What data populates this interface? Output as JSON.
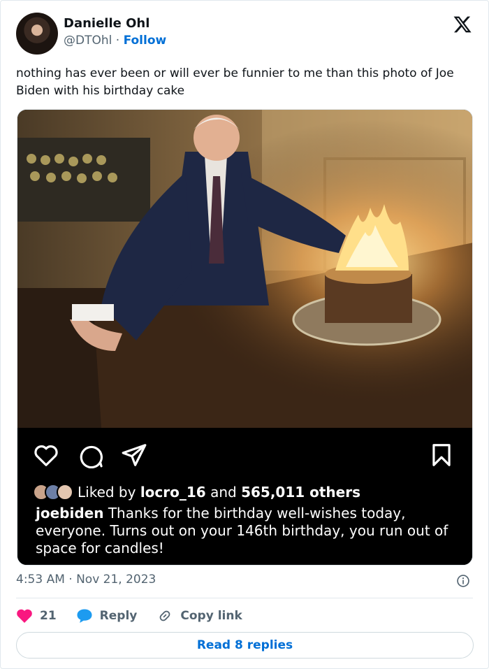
{
  "author": {
    "name": "Danielle Ohl",
    "handle": "@DTOhl",
    "separator": "·",
    "follow_label": "Follow"
  },
  "tweet": {
    "text": "nothing has ever been or will ever be funnier to me than this photo of Joe Biden with his birthday cake",
    "timestamp": "4:53 AM · Nov 21, 2023"
  },
  "instagram": {
    "liked_prefix": "Liked by",
    "liked_user": "locro_16",
    "liked_and": "and",
    "liked_others": "565,011 others",
    "caption_user": "joebiden",
    "caption_text": "Thanks for the birthday well-wishes today, everyone. Turns out on your 146th birthday, you run out of space for candles!"
  },
  "actions": {
    "like_count": "21",
    "reply_label": "Reply",
    "copy_label": "Copy link"
  },
  "read_replies_label": "Read 8 replies",
  "colors": {
    "link_blue": "#006fd6",
    "heart_red": "#f91880",
    "reply_blue": "#1d9bf0",
    "muted_text": "#536471"
  },
  "icons": [
    "x-logo-icon",
    "heart-outline-icon",
    "comment-icon",
    "share-icon",
    "bookmark-icon",
    "info-icon",
    "heart-icon",
    "reply-bubble-icon",
    "link-icon"
  ]
}
